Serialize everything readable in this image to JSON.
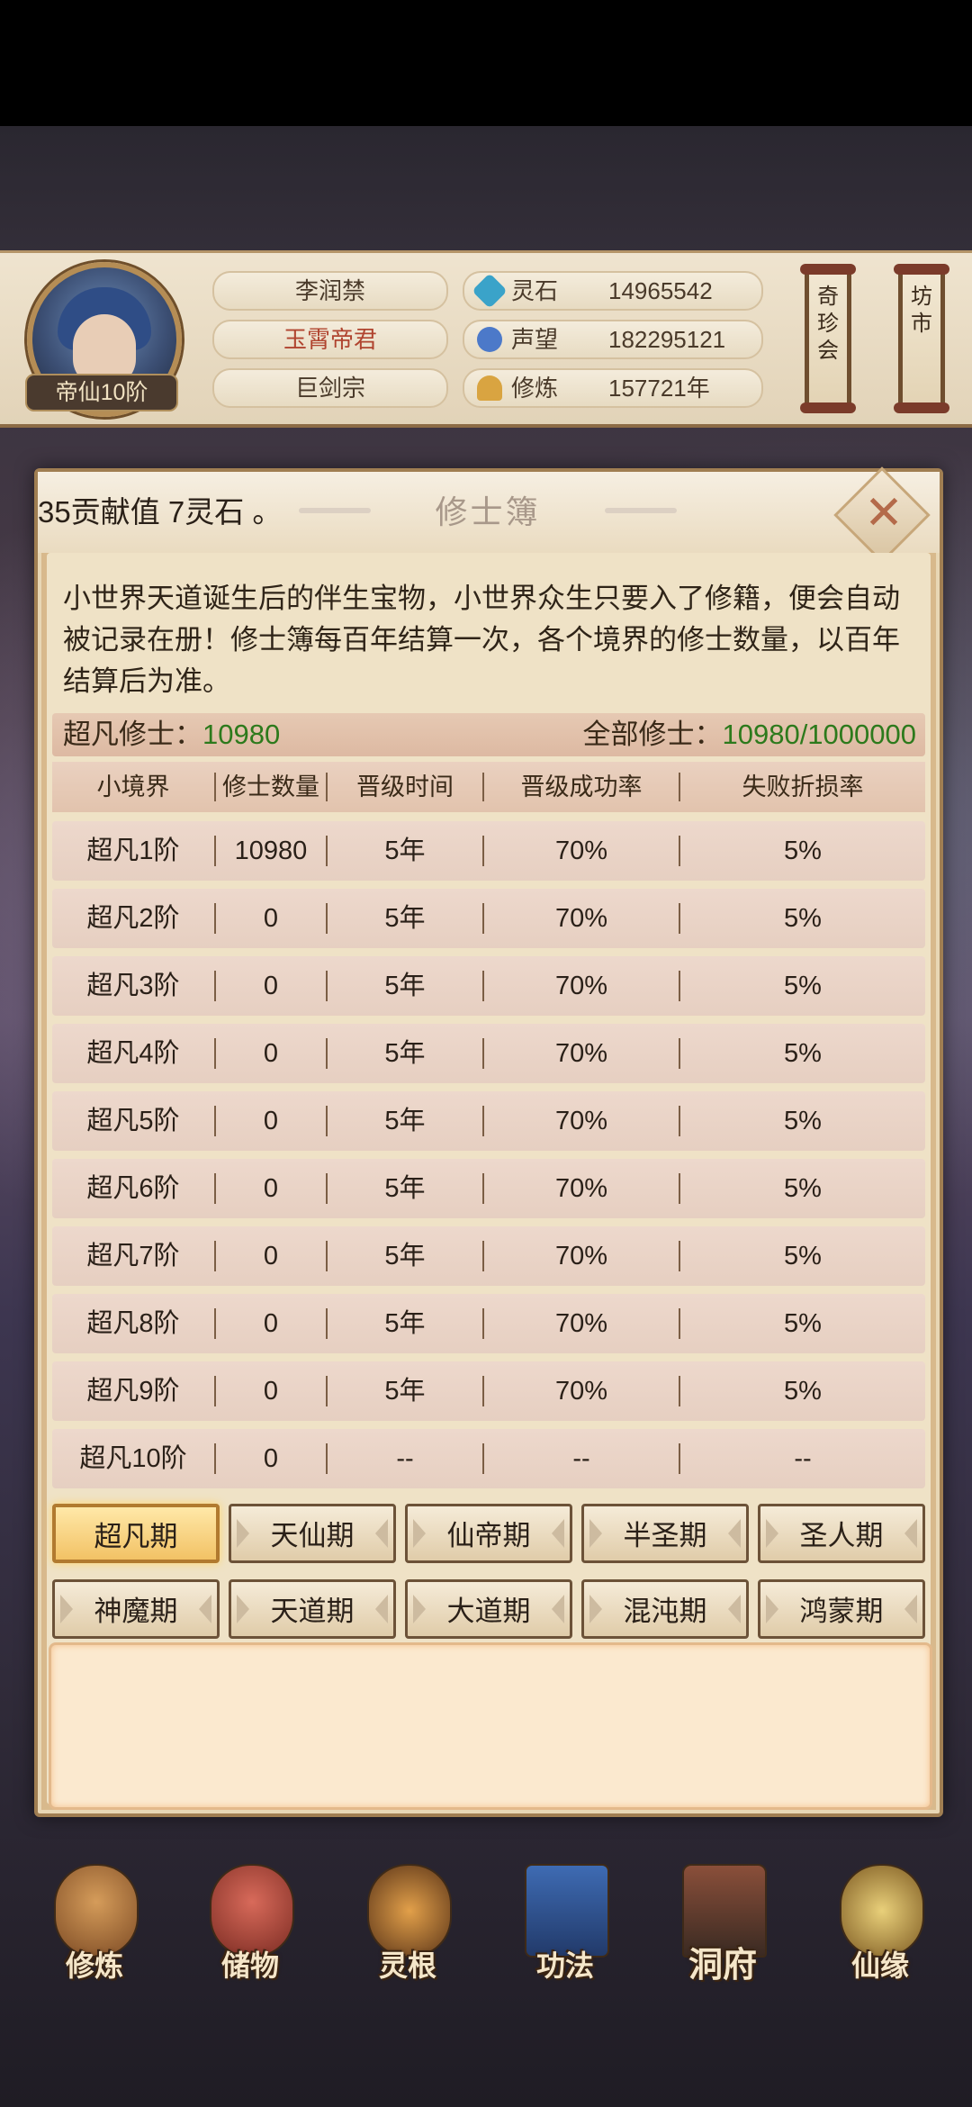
{
  "header": {
    "rank_badge": "帝仙10阶",
    "name": "李润禁",
    "title": "玉霄帝君",
    "sect": "巨剑宗",
    "stats": [
      {
        "icon": "spirit-stone-icon",
        "label": "灵石",
        "value": "14965542"
      },
      {
        "icon": "prestige-icon",
        "label": "声望",
        "value": "182295121"
      },
      {
        "icon": "cultivation-icon",
        "label": "修炼",
        "value": "157721年"
      }
    ],
    "side_scrolls": [
      "奇珍会",
      "坊市"
    ]
  },
  "dialog": {
    "ticker": "35贡献值 7灵石 。",
    "title": "修士簿",
    "description": "小世界天道诞生后的伴生宝物，小世界众生只要入了修籍，便会自动被记录在册！修士簿每百年结算一次，各个境界的修士数量，以百年结算后为准。",
    "summary": {
      "left_label": "超凡修士：",
      "left_value": "10980",
      "right_label": "全部修士：",
      "right_value": "10980/1000000"
    },
    "table": {
      "headers": [
        "小境界",
        "修士数量",
        "晋级时间",
        "晋级成功率",
        "失败折损率"
      ],
      "rows": [
        [
          "超凡1阶",
          "10980",
          "5年",
          "70%",
          "5%"
        ],
        [
          "超凡2阶",
          "0",
          "5年",
          "70%",
          "5%"
        ],
        [
          "超凡3阶",
          "0",
          "5年",
          "70%",
          "5%"
        ],
        [
          "超凡4阶",
          "0",
          "5年",
          "70%",
          "5%"
        ],
        [
          "超凡5阶",
          "0",
          "5年",
          "70%",
          "5%"
        ],
        [
          "超凡6阶",
          "0",
          "5年",
          "70%",
          "5%"
        ],
        [
          "超凡7阶",
          "0",
          "5年",
          "70%",
          "5%"
        ],
        [
          "超凡8阶",
          "0",
          "5年",
          "70%",
          "5%"
        ],
        [
          "超凡9阶",
          "0",
          "5年",
          "70%",
          "5%"
        ],
        [
          "超凡10阶",
          "0",
          "--",
          "--",
          "--"
        ]
      ]
    },
    "tabs": [
      [
        "超凡期",
        "天仙期",
        "仙帝期",
        "半圣期",
        "圣人期"
      ],
      [
        "神魔期",
        "天道期",
        "大道期",
        "混沌期",
        "鸿蒙期"
      ]
    ],
    "active_tab": "超凡期"
  },
  "bottom_nav": [
    "修炼",
    "储物",
    "灵根",
    "功法",
    "洞府",
    "仙缘"
  ],
  "colors": {
    "highlight_green": "#2d7a1c",
    "title_red": "#b0442f",
    "active_tab_gold": "#f2c265"
  }
}
